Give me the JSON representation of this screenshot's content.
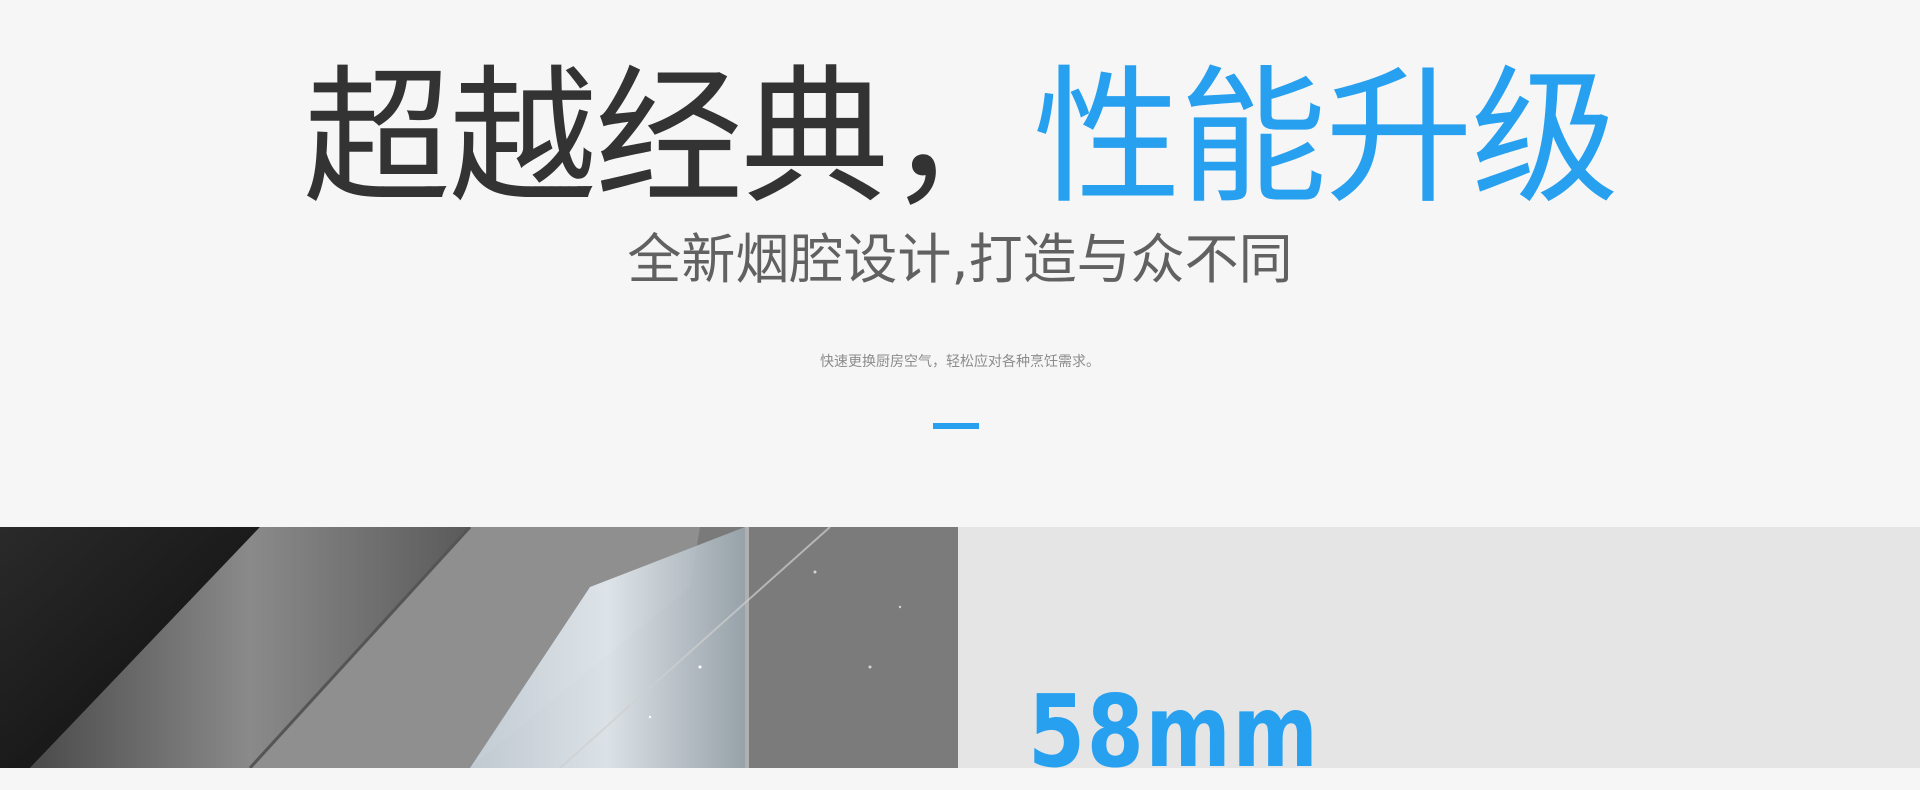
{
  "hero": {
    "headline_dark": "超越经典，",
    "headline_blue": "性能升级",
    "subheadline": "全新烟腔设计,打造与众不同",
    "tagline": "快速更换厨房空气，轻松应对各种烹饪需求。"
  },
  "spec": {
    "value": "58mm"
  },
  "colors": {
    "accent": "#27a0f0",
    "heading": "#333333",
    "subheading": "#616161",
    "background": "#f6f6f6",
    "panel": "#e5e5e5"
  }
}
